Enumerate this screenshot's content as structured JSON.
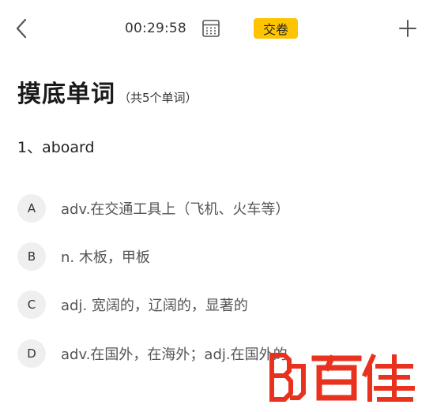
{
  "header": {
    "back_icon": "chevron-left-icon",
    "timer": "00:29:58",
    "answer_sheet_icon": "answer-sheet-grid-icon",
    "submit_label": "交卷",
    "add_icon": "plus-icon",
    "accent_color": "#ffc400"
  },
  "section": {
    "title": "摸底单词",
    "subtitle": "（共5个单词）"
  },
  "question": {
    "text": "1、aboard"
  },
  "options": [
    {
      "letter": "A",
      "text": "adv.在交通工具上（飞机、火车等）"
    },
    {
      "letter": "B",
      "text": "n. 木板，甲板"
    },
    {
      "letter": "C",
      "text": "adj. 宽阔的，辽阔的，显著的"
    },
    {
      "letter": "D",
      "text": "adv.在国外，在海外；adj.在国外的"
    }
  ],
  "watermark": {
    "logo_text": "百佳",
    "color": "#e8321e"
  }
}
